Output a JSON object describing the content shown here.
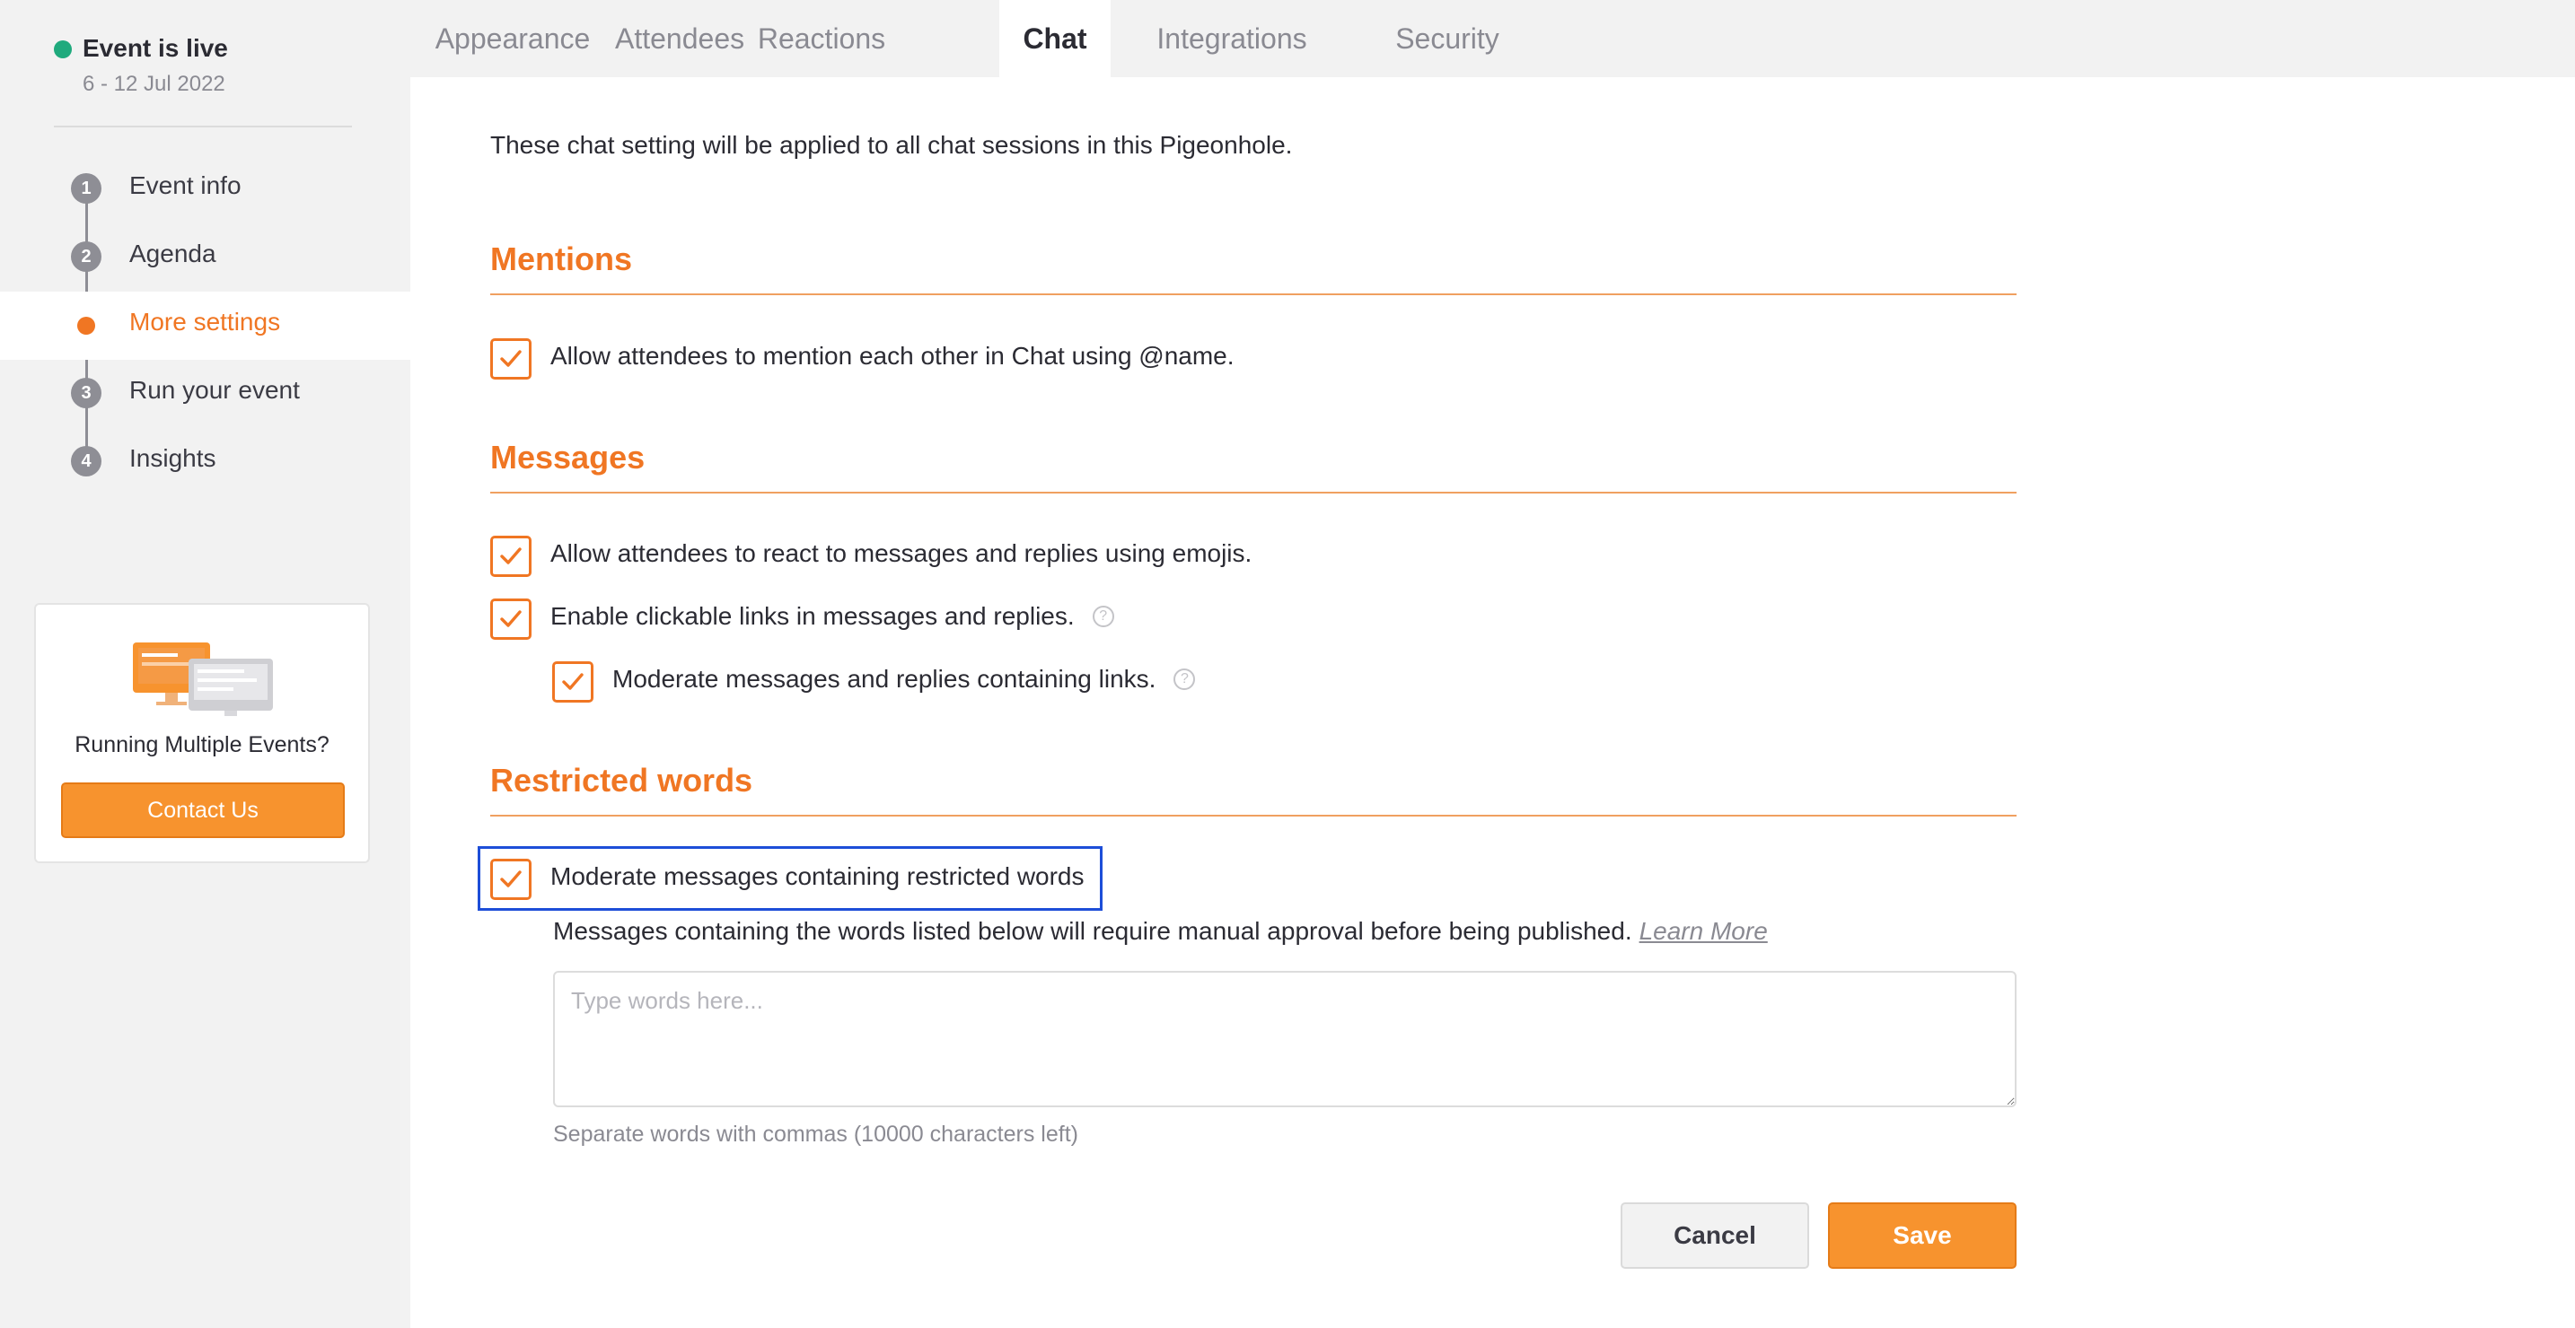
{
  "event_status": {
    "title": "Event is live",
    "date": "6 - 12 Jul 2022",
    "dot_color": "#1faa7d"
  },
  "sidebar": {
    "steps": [
      {
        "number": "1",
        "label": "Event info",
        "active": false
      },
      {
        "number": "2",
        "label": "Agenda",
        "active": false
      },
      {
        "number": "",
        "label": "More settings",
        "active": true
      },
      {
        "number": "3",
        "label": "Run your event",
        "active": false
      },
      {
        "number": "4",
        "label": "Insights",
        "active": false
      }
    ],
    "promo": {
      "icon": "monitors-illustration-icon",
      "text": "Running Multiple Events?",
      "button_label": "Contact Us"
    }
  },
  "tabs": [
    {
      "label": "Appearance",
      "active": false
    },
    {
      "label": "Attendees",
      "active": false
    },
    {
      "label": "Reactions",
      "active": false
    },
    {
      "label": "Chat",
      "active": true
    },
    {
      "label": "Integrations",
      "active": false
    },
    {
      "label": "Security",
      "active": false
    }
  ],
  "main": {
    "intro": "These chat setting will be applied to all chat sessions in this Pigeonhole.",
    "mentions": {
      "title": "Mentions",
      "options": [
        {
          "label": "Allow attendees to mention each other in Chat using @name.",
          "checked": true
        }
      ]
    },
    "messages": {
      "title": "Messages",
      "options": [
        {
          "label": "Allow attendees to react to messages and replies using emojis.",
          "checked": true
        },
        {
          "label": "Enable clickable links in messages and replies.",
          "checked": true,
          "help_icon": "question-circle-icon"
        },
        {
          "label": "Moderate messages and replies containing links.",
          "checked": true,
          "help_icon": "question-circle-icon"
        }
      ]
    },
    "restricted_words": {
      "title": "Restricted words",
      "option": {
        "label": "Moderate messages containing restricted words",
        "checked": true
      },
      "description": "Messages containing the words listed below will require manual approval before being published.",
      "learn_more": "Learn More",
      "input_value": "",
      "input_placeholder": "Type words here...",
      "hint": "Separate words with commas (10000 characters left)"
    },
    "buttons": {
      "cancel": "Cancel",
      "save": "Save"
    }
  },
  "colors": {
    "accent": "#f07623",
    "button_orange": "#f7932e",
    "focus_outline": "#1d4ed8",
    "sidebar_bg": "#f2f2f2"
  }
}
